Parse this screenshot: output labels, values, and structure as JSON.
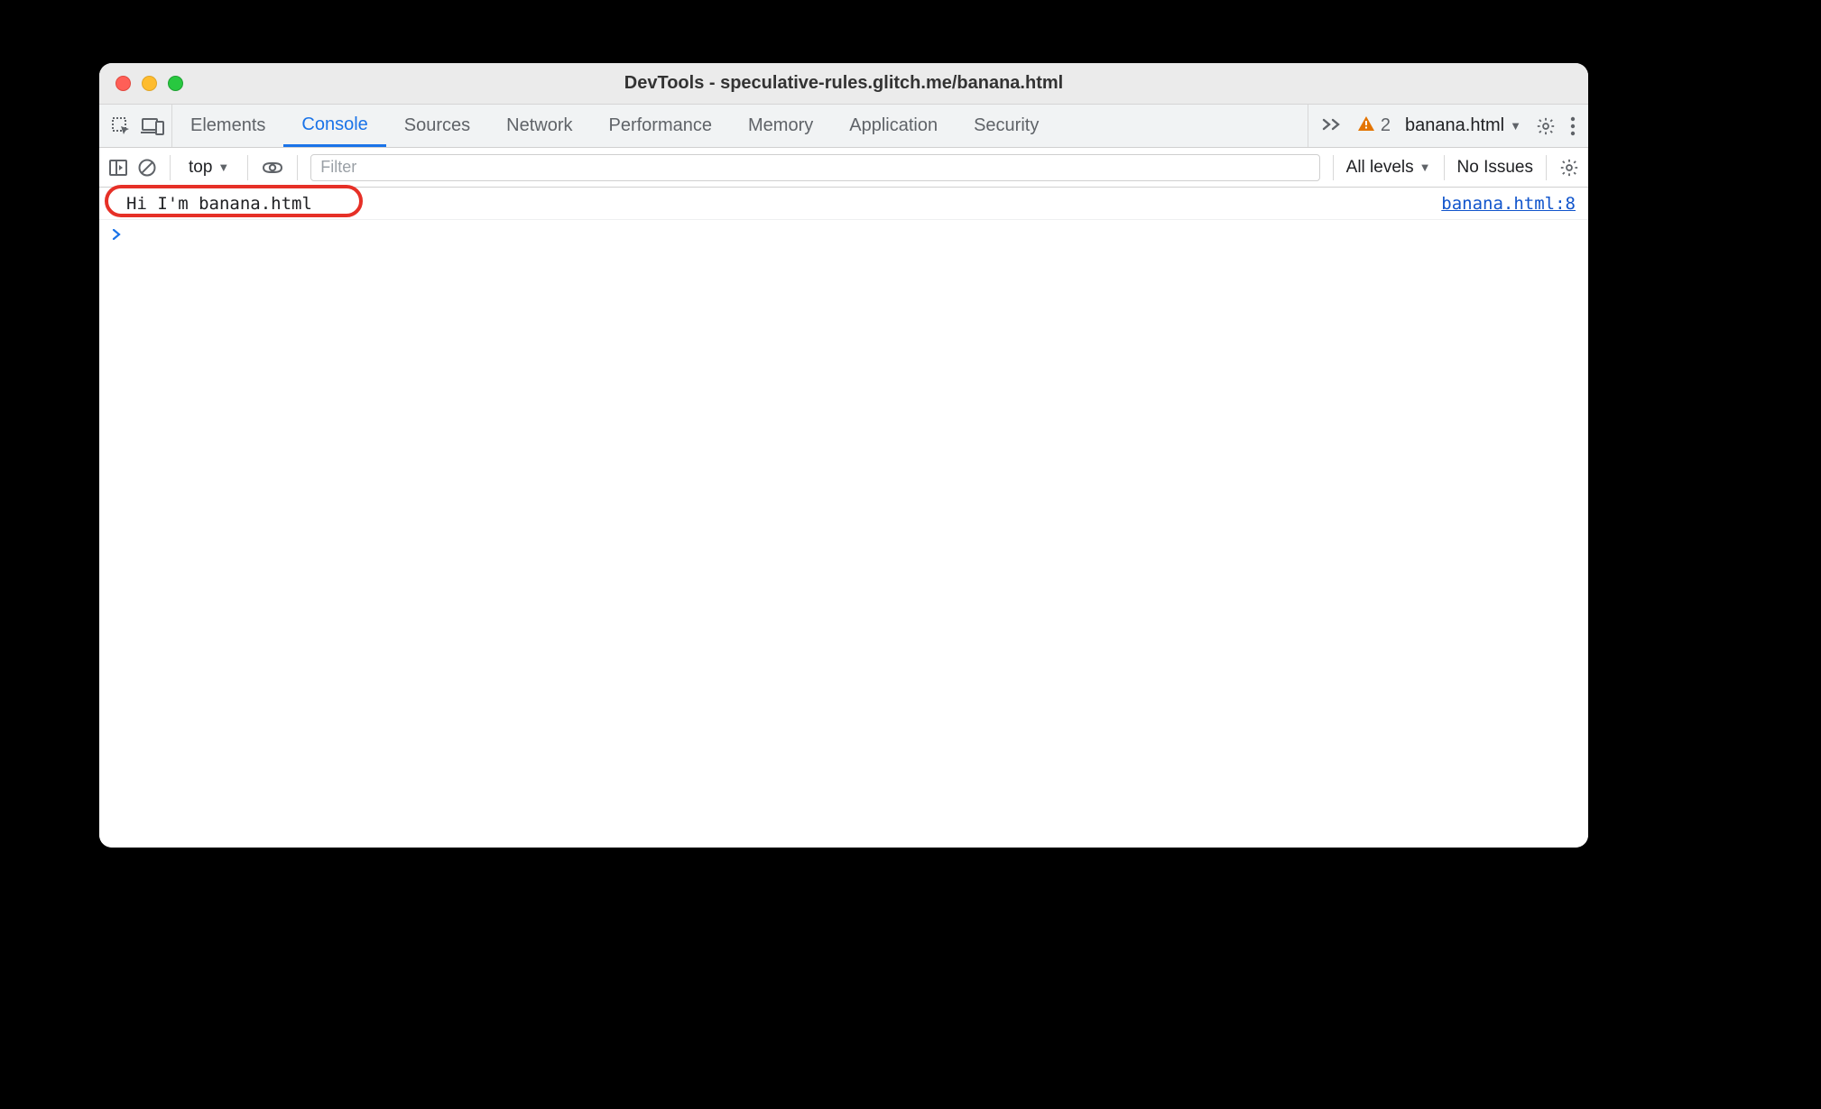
{
  "window": {
    "title": "DevTools - speculative-rules.glitch.me/banana.html"
  },
  "tabs": {
    "items": [
      "Elements",
      "Console",
      "Sources",
      "Network",
      "Performance",
      "Memory",
      "Application",
      "Security"
    ],
    "active": "Console"
  },
  "tabstrip_right": {
    "warning_count": "2",
    "page_name": "banana.html"
  },
  "console_toolbar": {
    "context": "top",
    "filter_placeholder": "Filter",
    "levels_label": "All levels",
    "issues_label": "No Issues"
  },
  "console": {
    "log_message": "Hi I'm banana.html",
    "log_source": "banana.html:8"
  }
}
